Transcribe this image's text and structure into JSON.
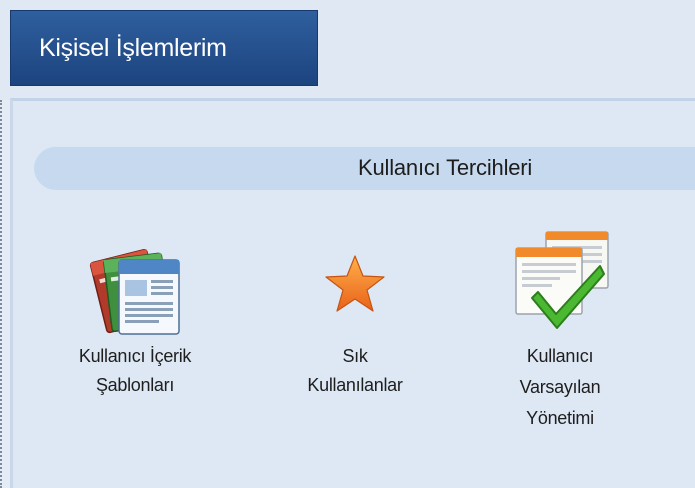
{
  "tab": {
    "label": "Kişisel İşlemlerim"
  },
  "section": {
    "title": "Kullanıcı Tercihleri"
  },
  "tools": [
    {
      "icon": "document-templates-icon",
      "label_lines": [
        "Kullanıcı İçerik",
        "Şablonları"
      ]
    },
    {
      "icon": "star-icon",
      "label_lines": [
        "Sık",
        "Kullanılanlar"
      ]
    },
    {
      "icon": "checklist-icon",
      "label_lines": [
        "Kullanıcı",
        "Varsayılan",
        "Yönetimi"
      ]
    }
  ],
  "colors": {
    "tab_background": "#1c447f",
    "section_header": "#c6d9ee",
    "panel_background": "#dee8f4",
    "star": "#f07a1e",
    "check": "#3faa2a"
  }
}
